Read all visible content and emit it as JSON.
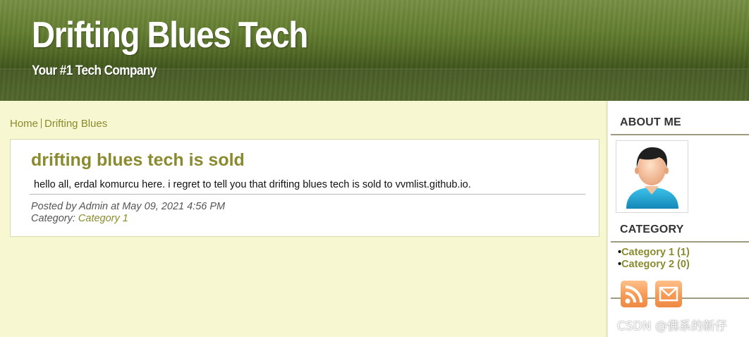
{
  "header": {
    "title": "Drifting Blues Tech",
    "tagline": "Your #1 Tech Company"
  },
  "breadcrumb": {
    "home": "Home",
    "current": "Drifting Blues"
  },
  "post": {
    "title": "drifting blues tech is sold",
    "body": "hello all, erdal komurcu here. i regret to tell you that drifting blues tech is sold to vvmlist.github.io.",
    "meta_posted": "Posted by Admin at May 09, 2021 4:56 PM",
    "meta_category_label": "Category:",
    "meta_category": "Category 1"
  },
  "sidebar": {
    "about_heading": "ABOUT ME",
    "category_heading": "CATEGORY",
    "categories": [
      {
        "label": "Category 1 (1)"
      },
      {
        "label": "Category 2 (0)"
      }
    ],
    "icons": [
      "rss-icon",
      "mail-icon"
    ]
  },
  "watermark": "CSDN @佛系的新仔",
  "colors": {
    "header_green": "#5f7a2d",
    "page_bg": "#f7f7d2",
    "link_olive": "#8a8a2e",
    "feed_orange": "#f59a55"
  }
}
